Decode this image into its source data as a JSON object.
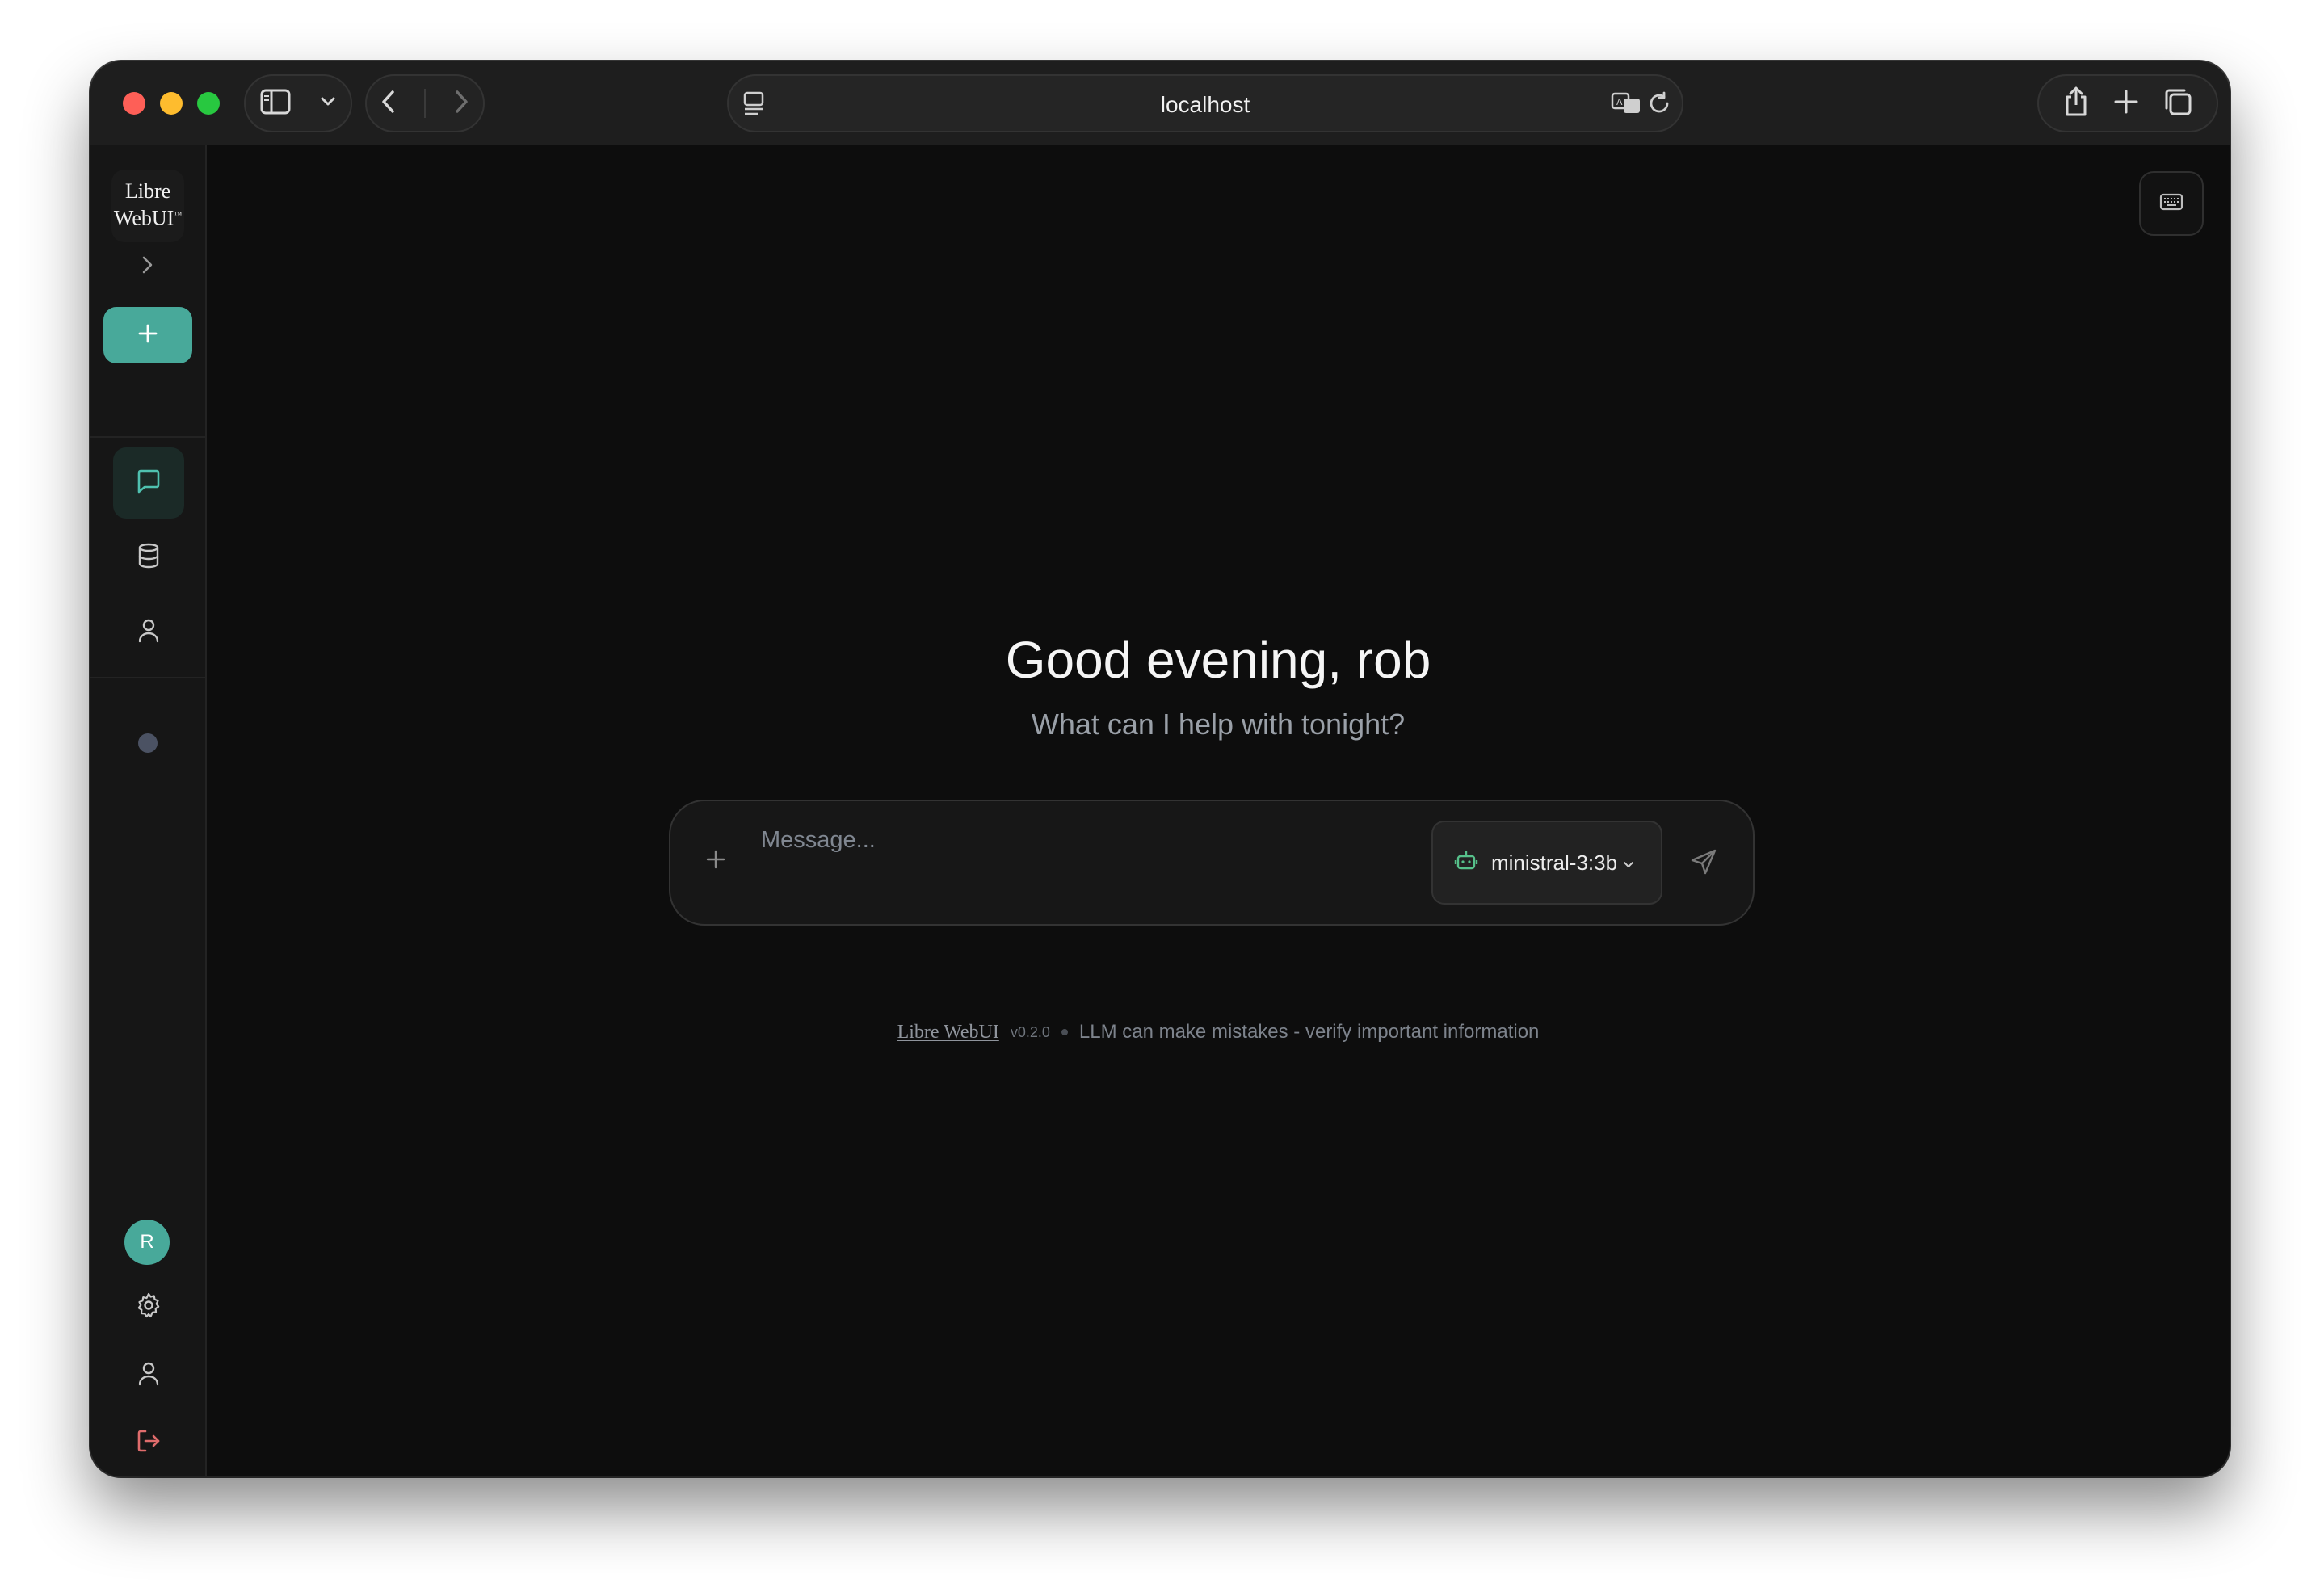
{
  "browser": {
    "url": "localhost"
  },
  "sidebar": {
    "logo_line1": "Libre",
    "logo_line2": "WebUI",
    "logo_mark": "™",
    "nav_items": [
      {
        "icon": "chat-icon",
        "active": true
      },
      {
        "icon": "database-icon",
        "active": false
      },
      {
        "icon": "user-icon",
        "active": false
      }
    ],
    "avatar_initial": "R",
    "colors": {
      "accent": "#48a99a",
      "logout": "#e06c6c",
      "status_dot": "#4b5263"
    }
  },
  "main": {
    "greeting": "Good evening, rob",
    "subtitle": "What can I help with tonight?",
    "composer": {
      "placeholder": "Message...",
      "model_name": "ministral-3:3b"
    },
    "footer": {
      "brand": "Libre WebUI",
      "version": "v0.2.0",
      "disclaimer": "LLM can make mistakes - verify important information"
    }
  }
}
